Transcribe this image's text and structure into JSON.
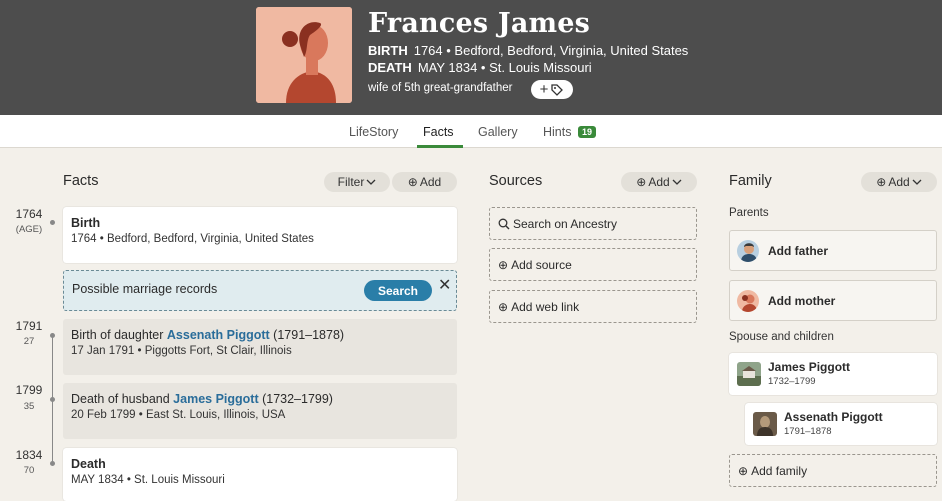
{
  "header": {
    "name": "Frances James",
    "birth_label": "BIRTH",
    "birth_value": "1764 • Bedford, Bedford, Virginia, United States",
    "death_label": "DEATH",
    "death_value": "MAY 1834 • St. Louis Missouri",
    "relation": "wife of 5th great-grandfather"
  },
  "tabs": [
    {
      "label": "LifeStory"
    },
    {
      "label": "Facts"
    },
    {
      "label": "Gallery"
    },
    {
      "label": "Hints"
    }
  ],
  "hints_count": "19",
  "facts": {
    "title": "Facts",
    "filter_label": "Filter",
    "add_label": "Add",
    "events": [
      {
        "year": "1764",
        "sub": "(AGE)",
        "title": "Birth",
        "detail": "1764 • Bedford, Bedford, Virginia, United States"
      },
      {
        "year": "1791",
        "sub": "27",
        "title_prefix": "Birth of daughter ",
        "link": "Assenath Piggott",
        "suffix": " (1791–1878)",
        "detail": "17 Jan 1791 • Piggotts Fort, St Clair, Illinois"
      },
      {
        "year": "1799",
        "sub": "35",
        "title_prefix": "Death of husband ",
        "link": "James Piggott",
        "suffix": " (1732–1799)",
        "detail": "20 Feb 1799 • East St. Louis, Illinois, USA"
      },
      {
        "year": "1834",
        "sub": "70",
        "title": "Death",
        "detail": "MAY 1834 • St. Louis Missouri"
      }
    ],
    "marriage_prompt": "Possible marriage records",
    "search_label": "Search"
  },
  "sources": {
    "title": "Sources",
    "add_label": "Add",
    "search_ancestry": "Search on Ancestry",
    "add_source": "Add source",
    "add_web_link": "Add web link"
  },
  "family": {
    "title": "Family",
    "add_label": "Add",
    "parents_label": "Parents",
    "add_father": "Add father",
    "add_mother": "Add mother",
    "spouse_label": "Spouse and children",
    "spouse_name": "James Piggott",
    "spouse_dates": "1732–1799",
    "child_name": "Assenath Piggott",
    "child_dates": "1791–1878",
    "add_family": "Add family"
  },
  "colors": {
    "header_bg": "#4d4d4d",
    "accent_green": "#3a8a3a",
    "link_blue": "#2a6d9a",
    "search_blue": "#2a7ea8"
  }
}
